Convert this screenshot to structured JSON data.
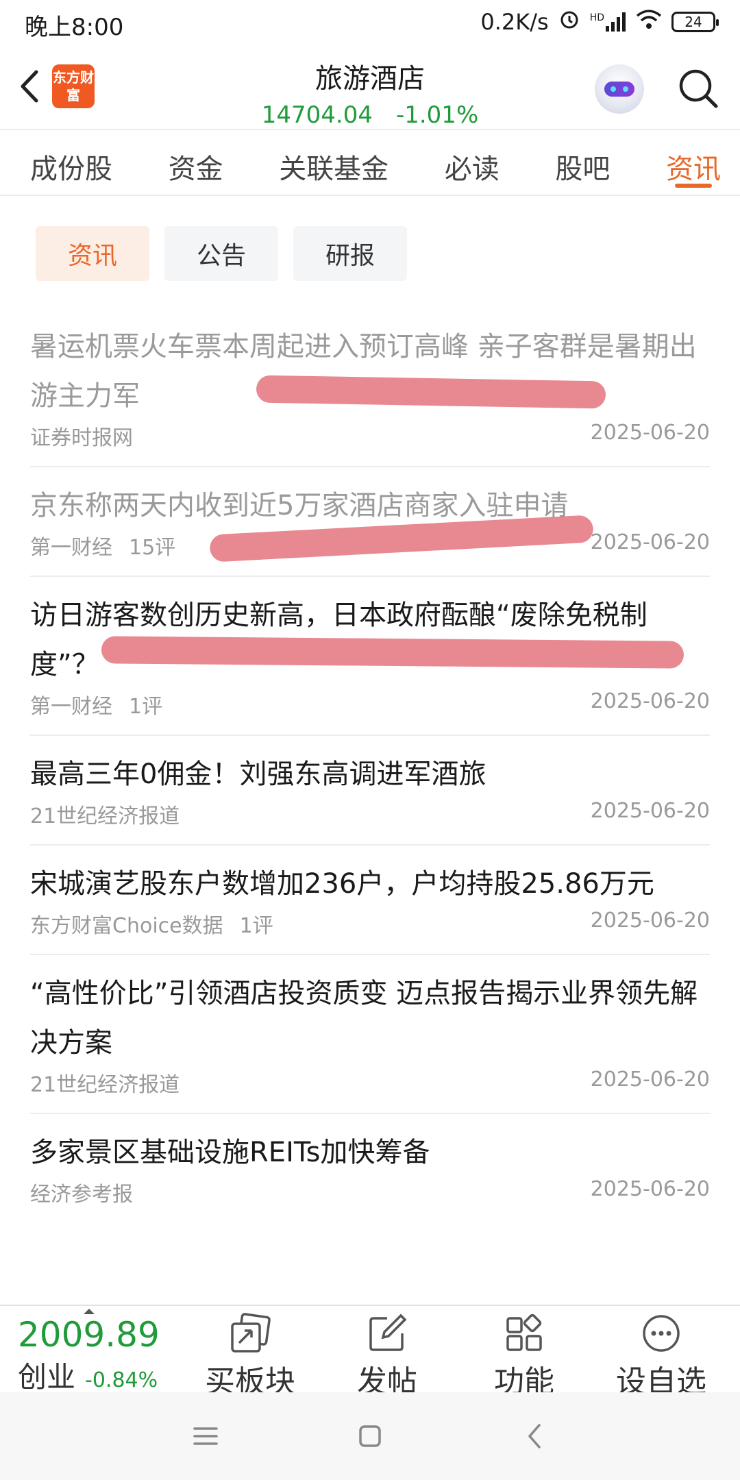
{
  "status_bar": {
    "time": "晚上8:00",
    "net_speed": "0.2K/s",
    "signal": "HD",
    "battery": "24"
  },
  "header": {
    "logo_text": "东方财富",
    "title": "旅游酒店",
    "price": "14704.04",
    "change": "-1.01%"
  },
  "main_tabs": [
    {
      "label": "成份股"
    },
    {
      "label": "资金"
    },
    {
      "label": "关联基金"
    },
    {
      "label": "必读"
    },
    {
      "label": "股吧"
    },
    {
      "label": "资讯",
      "active": true
    }
  ],
  "sub_tabs": [
    {
      "label": "资讯",
      "active": true
    },
    {
      "label": "公告"
    },
    {
      "label": "研报"
    }
  ],
  "news": [
    {
      "title": "暑运机票火车票本周起进入预订高峰 亲子客群是暑期出游主力军",
      "source": "证券时报网",
      "comments": "",
      "date": "2025-06-20",
      "read": true
    },
    {
      "title": "京东称两天内收到近5万家酒店商家入驻申请",
      "source": "第一财经",
      "comments": "15评",
      "date": "2025-06-20",
      "read": true
    },
    {
      "title": "访日游客数创历史新高，日本政府酝酿“废除免税制度”？",
      "source": "第一财经",
      "comments": "1评",
      "date": "2025-06-20",
      "read": false
    },
    {
      "title": "最高三年0佣金！刘强东高调进军酒旅",
      "source": "21世纪经济报道",
      "comments": "",
      "date": "2025-06-20",
      "read": false
    },
    {
      "title": "宋城演艺股东户数增加236户，户均持股25.86万元",
      "source": "东方财富Choice数据",
      "comments": "1评",
      "date": "2025-06-20",
      "read": false
    },
    {
      "title": "“高性价比”引领酒店投资质变 迈点报告揭示业界领先解决方案",
      "source": "21世纪经济报道",
      "comments": "",
      "date": "2025-06-20",
      "read": false
    },
    {
      "title": "多家景区基础设施REITs加快筹备",
      "source": "经济参考报",
      "comments": "",
      "date": "2025-06-20",
      "read": false
    }
  ],
  "bottom_bar": {
    "index_value": "2009.89",
    "index_name": "创业",
    "index_change": "-0.84%",
    "actions": [
      {
        "label": "买板块",
        "icon": "sector-icon"
      },
      {
        "label": "发帖",
        "icon": "edit-icon"
      },
      {
        "label": "功能",
        "icon": "grid-icon"
      },
      {
        "label": "设自选",
        "icon": "more-icon"
      }
    ]
  },
  "colors": {
    "accent": "#e8682b",
    "down_green": "#1f9b3a",
    "scribble": "#e0606c"
  }
}
